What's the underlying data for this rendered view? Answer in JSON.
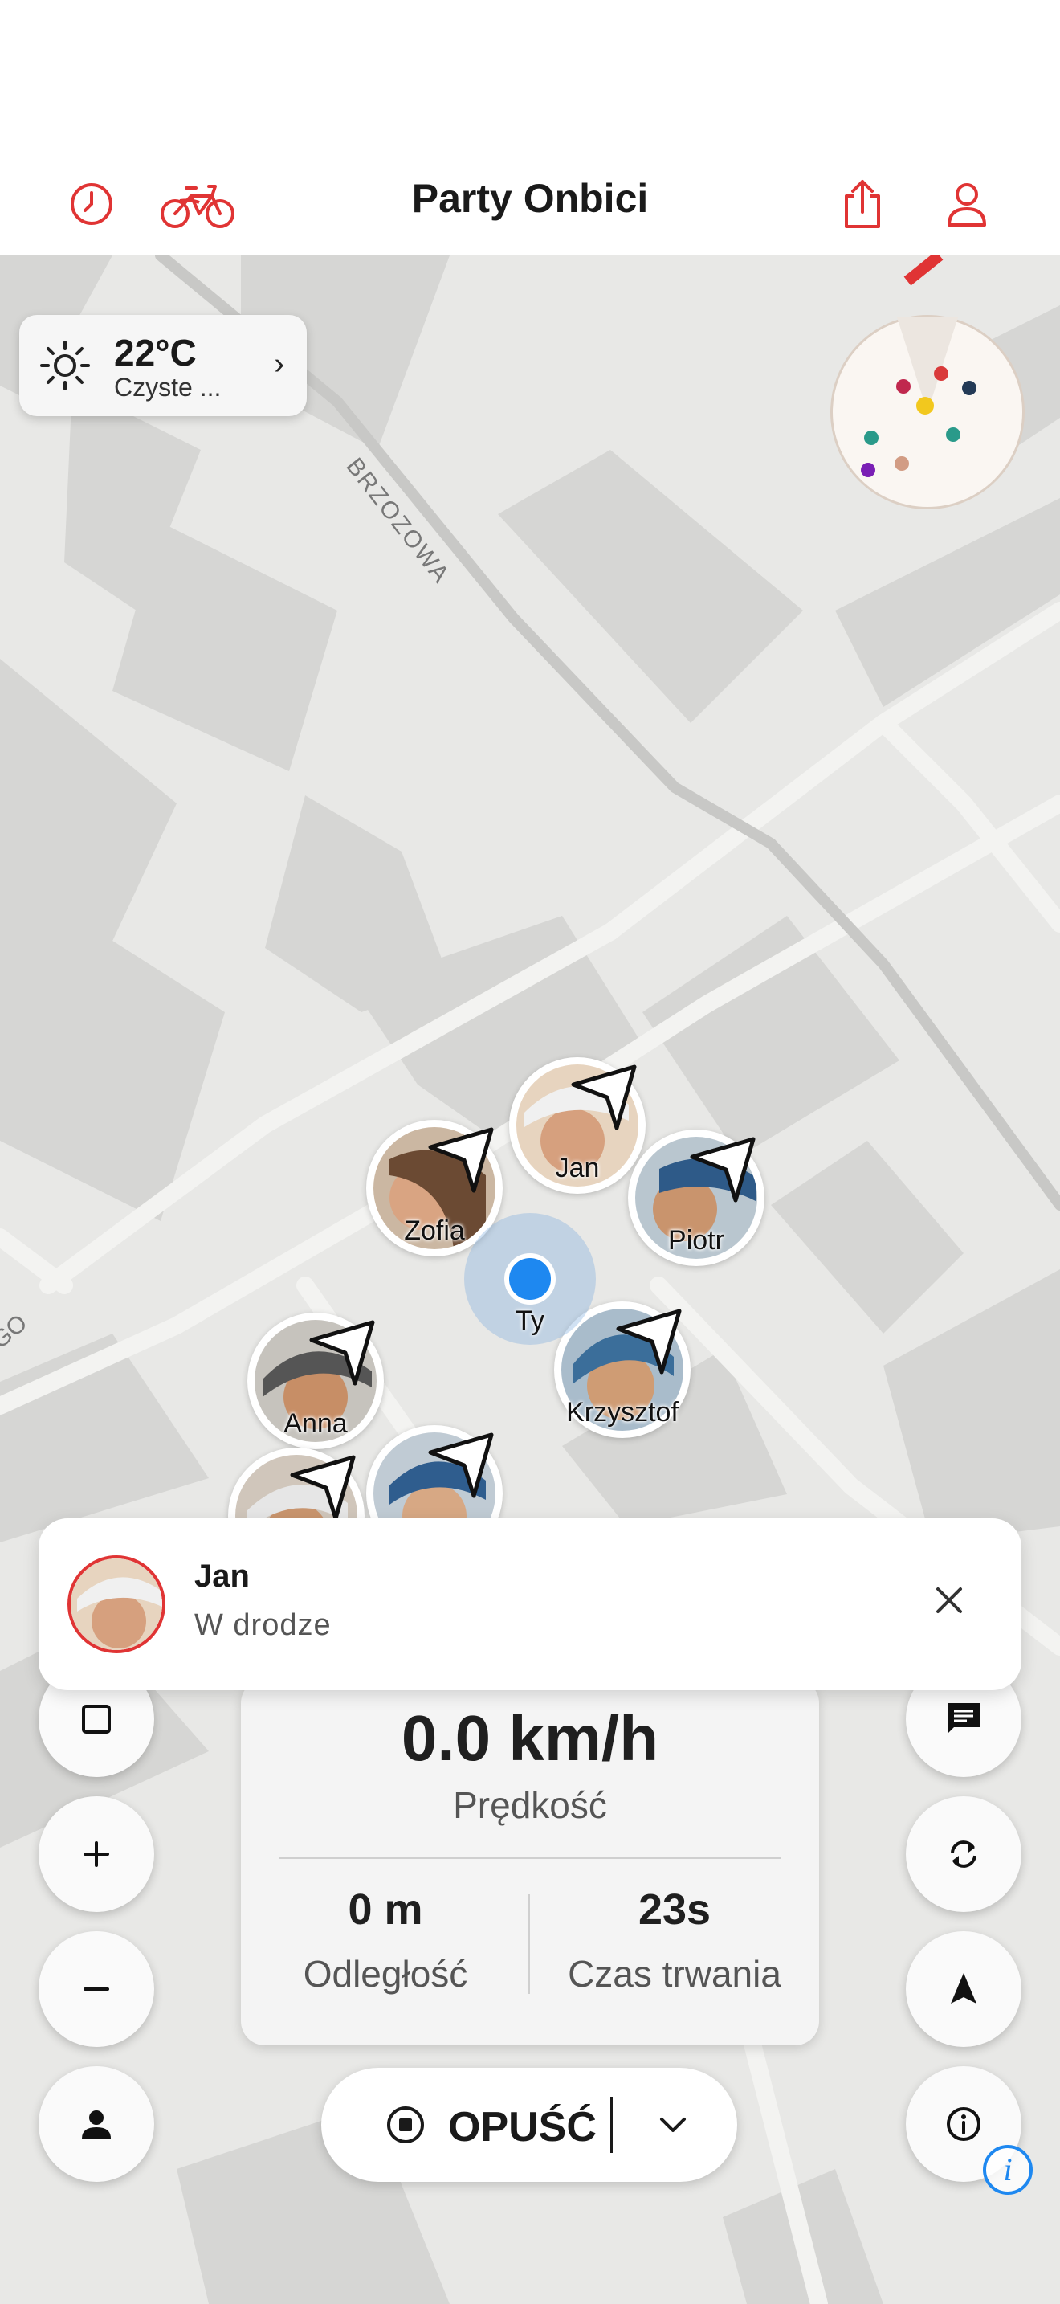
{
  "header": {
    "title": "Party Onbici",
    "history_icon": "clock-icon",
    "bike_icon": "bicycle-icon",
    "share_icon": "share-icon",
    "profile_icon": "person-icon"
  },
  "map": {
    "street_label_1": "BRZOZOWA",
    "street_label_2": "GO"
  },
  "weather": {
    "temperature": "22°C",
    "condition": "Czyste ...",
    "icon": "sun-icon"
  },
  "riders": [
    {
      "name": "Jan"
    },
    {
      "name": "Zofia"
    },
    {
      "name": "Piotr"
    },
    {
      "name": "Krzysztof"
    },
    {
      "name": "Anna"
    },
    {
      "name": ""
    },
    {
      "name": ""
    }
  ],
  "me": {
    "label": "Ty"
  },
  "notification": {
    "name": "Jan",
    "status": "W drodze"
  },
  "stats": {
    "speed": "0.0 km/h",
    "speed_label": "Prędkość",
    "distance": "0 m",
    "distance_label": "Odległość",
    "duration": "23s",
    "duration_label": "Czas trwania"
  },
  "leave_button": {
    "label": "OPUŚĆ"
  },
  "colors": {
    "accent": "#e03434",
    "blue": "#1e88f0",
    "map_bg": "#e8e8e6",
    "building": "#d6d6d4"
  }
}
